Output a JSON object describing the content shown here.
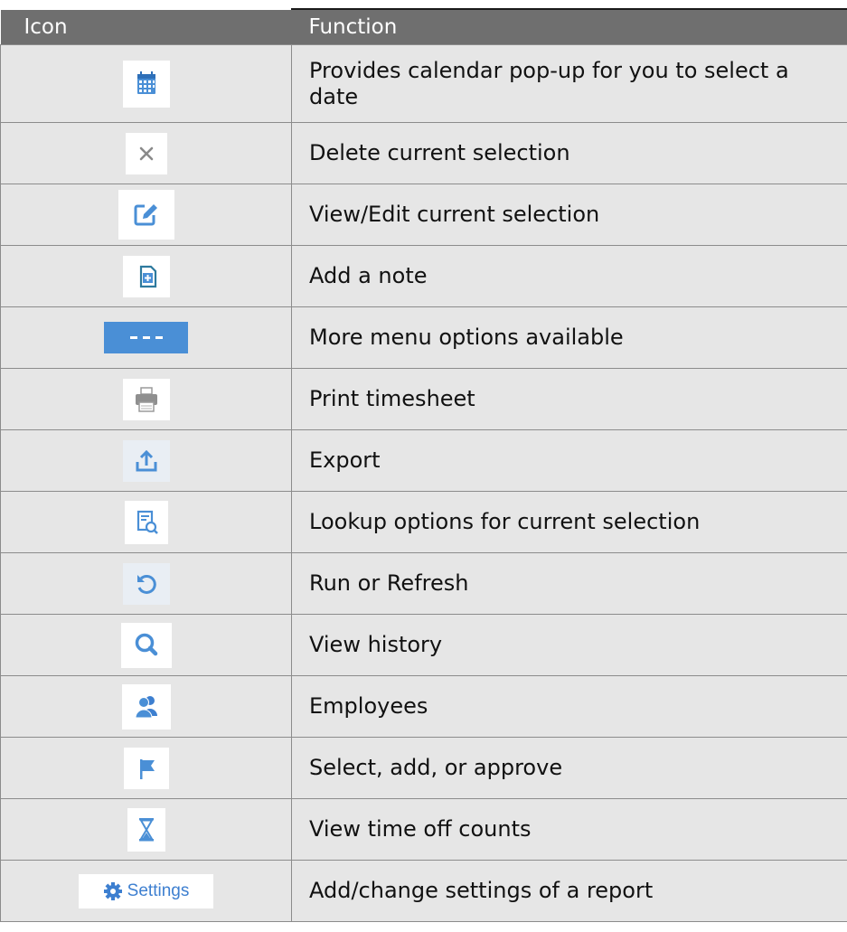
{
  "table": {
    "headers": {
      "icon": "Icon",
      "function": "Function"
    },
    "rows": [
      {
        "icon": "calendar-icon",
        "function": "Provides calendar pop-up for you to select a date"
      },
      {
        "icon": "close-icon",
        "function": "Delete current selection"
      },
      {
        "icon": "edit-icon",
        "function": "View/Edit current selection"
      },
      {
        "icon": "add-note-icon",
        "function": "Add a note"
      },
      {
        "icon": "more-options-icon",
        "function": "More menu options available"
      },
      {
        "icon": "print-icon",
        "function": "Print timesheet"
      },
      {
        "icon": "export-icon",
        "function": "Export"
      },
      {
        "icon": "lookup-icon",
        "function": "Lookup options for current selection"
      },
      {
        "icon": "refresh-icon",
        "function": "Run or Refresh"
      },
      {
        "icon": "search-icon",
        "function": "View history"
      },
      {
        "icon": "employees-icon",
        "function": "Employees"
      },
      {
        "icon": "flag-icon",
        "function": "Select, add, or approve"
      },
      {
        "icon": "hourglass-icon",
        "function": "View time off counts"
      },
      {
        "icon": "settings-button-icon",
        "function": "Add/change settings of a report",
        "icon_label": "Settings"
      }
    ]
  },
  "colors": {
    "header_bg": "#6f6f6f",
    "cell_bg": "#e6e6e6",
    "icon_blue": "#4a8fd6",
    "border": "#8c8c8c"
  }
}
